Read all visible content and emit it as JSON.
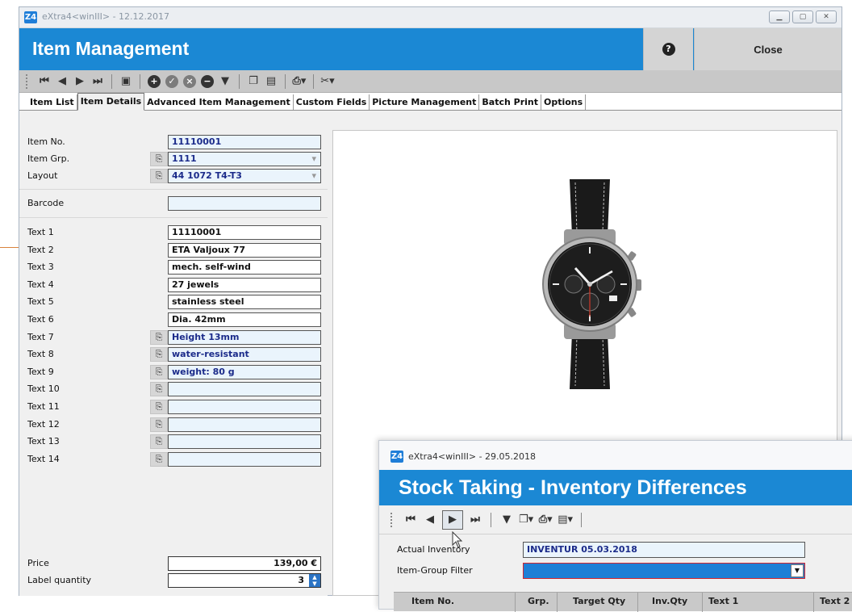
{
  "main_window": {
    "window_title": "eXtra4<winIII> - 12.12.2017",
    "app_logo": "Z4",
    "header_title": "Item Management",
    "help_label": "?",
    "close_label": "Close",
    "toolbar_icons": [
      "first-icon",
      "prev-icon",
      "next-icon",
      "last-icon",
      "record-icon",
      "add-icon",
      "confirm-icon",
      "cancel-icon",
      "remove-icon",
      "filter-icon",
      "copy-icon",
      "paste-icon",
      "print-icon",
      "tools-icon"
    ],
    "tabs": [
      {
        "label": "Item List"
      },
      {
        "label": "Item Details"
      },
      {
        "label": "Advanced Item Management"
      },
      {
        "label": "Custom Fields"
      },
      {
        "label": "Picture Management"
      },
      {
        "label": "Batch Print"
      },
      {
        "label": "Options"
      }
    ],
    "active_tab": "Item Details",
    "fields": {
      "item_no": {
        "label": "Item No.",
        "value": "11110001"
      },
      "item_grp": {
        "label": "Item Grp.",
        "value": "1111"
      },
      "layout": {
        "label": "Layout",
        "value": "44 1072 T4-T3"
      },
      "barcode": {
        "label": "Barcode",
        "value": ""
      }
    },
    "texts": [
      {
        "label": "Text 1",
        "value": "11110001"
      },
      {
        "label": "Text 2",
        "value": "ETA Valjoux 77"
      },
      {
        "label": "Text 3",
        "value": "mech. self-wind"
      },
      {
        "label": "Text 4",
        "value": "27 jewels"
      },
      {
        "label": "Text 5",
        "value": "stainless steel"
      },
      {
        "label": "Text 6",
        "value": "Dia. 42mm"
      },
      {
        "label": "Text 7",
        "value": "Height 13mm"
      },
      {
        "label": "Text 8",
        "value": "water-resistant"
      },
      {
        "label": "Text 9",
        "value": "weight: 80 g"
      },
      {
        "label": "Text 10",
        "value": ""
      },
      {
        "label": "Text 11",
        "value": ""
      },
      {
        "label": "Text 12",
        "value": ""
      },
      {
        "label": "Text 13",
        "value": ""
      },
      {
        "label": "Text 14",
        "value": ""
      }
    ],
    "price": {
      "label": "Price",
      "value": "139,00 €"
    },
    "label_quantity": {
      "label": "Label quantity",
      "value": "3"
    }
  },
  "stock_window": {
    "window_title": "eXtra4<winIII> - 29.05.2018",
    "app_logo": "Z4",
    "header_title": "Stock Taking - Inventory Differences",
    "actual_inventory": {
      "label": "Actual Inventory",
      "value": "INVENTUR 05.03.2018"
    },
    "item_group_filter": {
      "label": "Item-Group Filter",
      "value": ""
    },
    "grid_columns": [
      "Item No.",
      "Grp.",
      "Target Qty",
      "Inv.Qty",
      "Text 1",
      "Text 2"
    ]
  },
  "colors": {
    "header_blue": "#1b88d4",
    "field_blue_bg": "#eaf4fc",
    "field_blue_text": "#1b2b8a",
    "select_highlight": "#1e7fd6",
    "select_border": "#d3262e",
    "leader_line": "#d9823c"
  }
}
